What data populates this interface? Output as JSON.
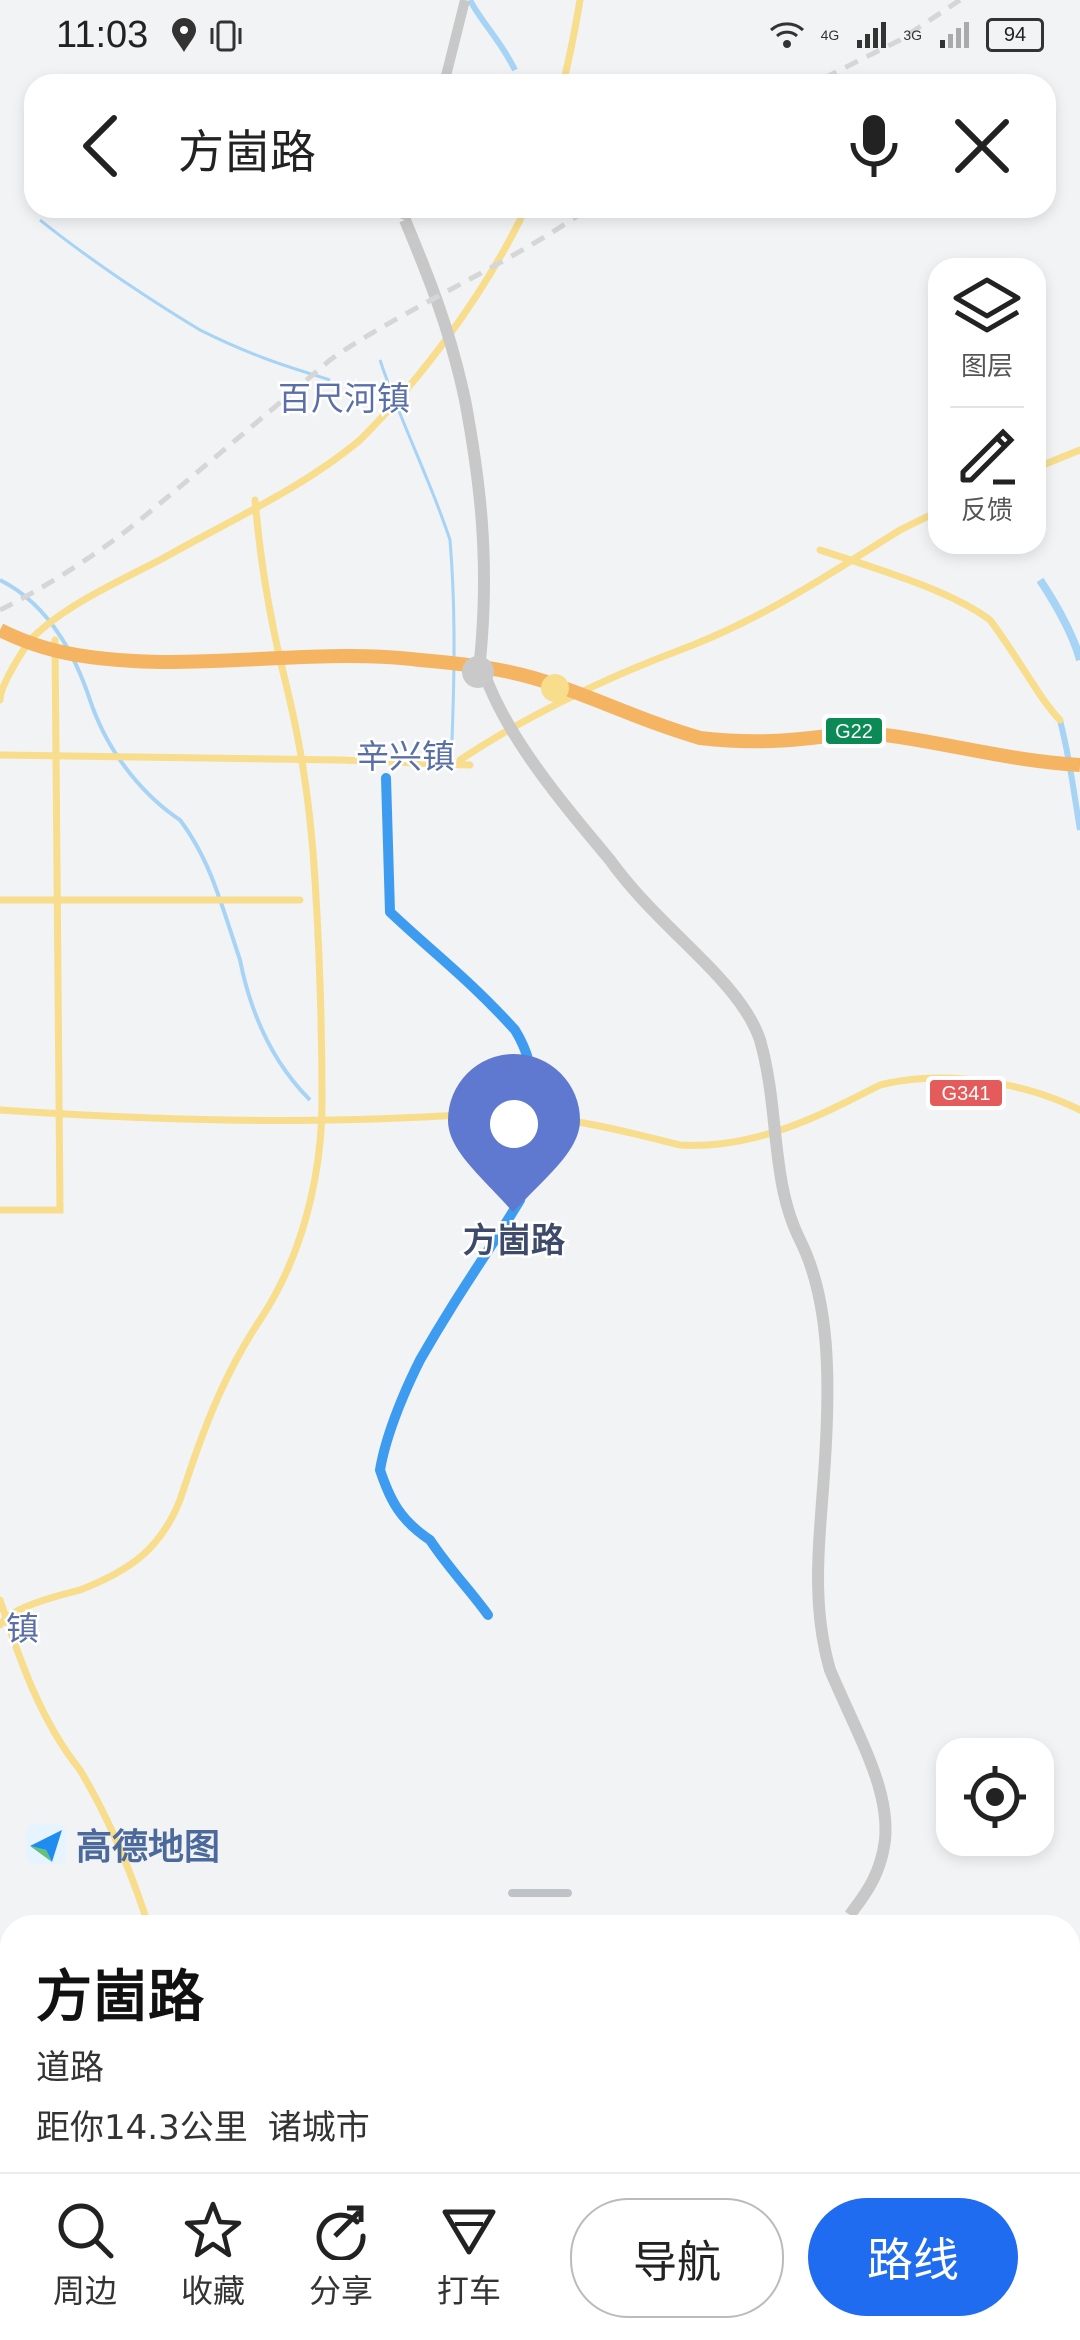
{
  "status_bar": {
    "time": "11:03",
    "net1": "4G",
    "net2": "3G",
    "battery": "94"
  },
  "search": {
    "query": "方崮路"
  },
  "side_panel": {
    "layers_label": "图层",
    "feedback_label": "反馈"
  },
  "map": {
    "town_1": "百尺河镇",
    "town_2": "辛兴镇",
    "town_3": "镇",
    "road_badge_1": "G22",
    "road_badge_2": "G341",
    "pin_label": "方崮路",
    "logo_text": "高德地图",
    "colors": {
      "route": "#3d9cf0",
      "highway": "#f4b462",
      "road": "#f7dd8c",
      "railway": "#c8c8c8",
      "water": "#a7d3f5",
      "pin": "#5e79cf"
    }
  },
  "place": {
    "title": "方崮路",
    "type": "道路",
    "distance": "距你14.3公里",
    "city": "诸城市"
  },
  "actions": {
    "nearby": "周边",
    "favorite": "收藏",
    "share": "分享",
    "taxi": "打车",
    "navigate": "导航",
    "route": "路线"
  }
}
